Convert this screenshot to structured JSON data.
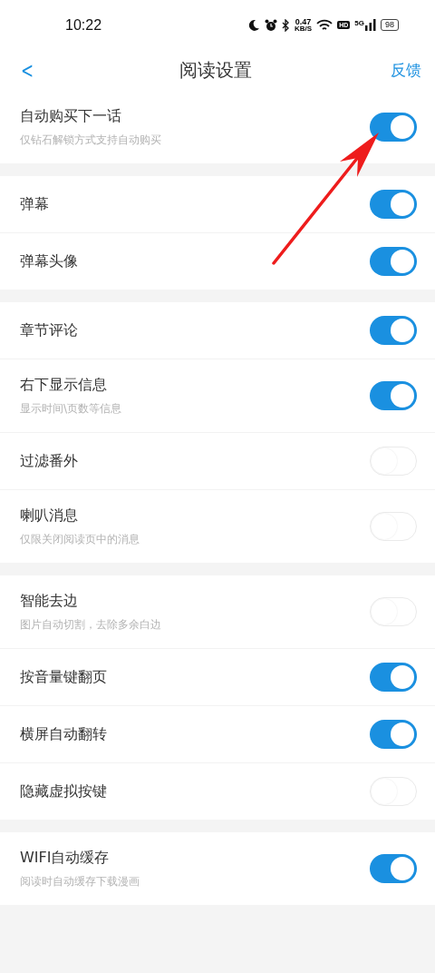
{
  "status_bar": {
    "time": "10:22",
    "net_speed": "0.47",
    "net_unit": "KB/S",
    "hd": "HD",
    "network": "5G",
    "battery": "98"
  },
  "header": {
    "back": "<",
    "title": "阅读设置",
    "action": "反馈"
  },
  "groups": [
    {
      "rows": [
        {
          "label": "自动购买下一话",
          "hint": "仅钻石解锁方式支持自动购买",
          "on": true
        }
      ]
    },
    {
      "rows": [
        {
          "label": "弹幕",
          "on": true
        },
        {
          "label": "弹幕头像",
          "on": true
        }
      ]
    },
    {
      "rows": [
        {
          "label": "章节评论",
          "on": true
        },
        {
          "label": "右下显示信息",
          "hint": "显示时间\\页数等信息",
          "on": true
        },
        {
          "label": "过滤番外",
          "on": false
        },
        {
          "label": "喇叭消息",
          "hint": "仅限关闭阅读页中的消息",
          "on": false
        }
      ]
    },
    {
      "rows": [
        {
          "label": "智能去边",
          "hint": "图片自动切割，去除多余白边",
          "on": false
        },
        {
          "label": "按音量键翻页",
          "on": true
        },
        {
          "label": "横屏自动翻转",
          "on": true
        },
        {
          "label": "隐藏虚拟按键",
          "on": false
        }
      ]
    },
    {
      "rows": [
        {
          "label": "WIFI自动缓存",
          "hint": "阅读时自动缓存下载漫画",
          "on": true
        }
      ]
    }
  ]
}
